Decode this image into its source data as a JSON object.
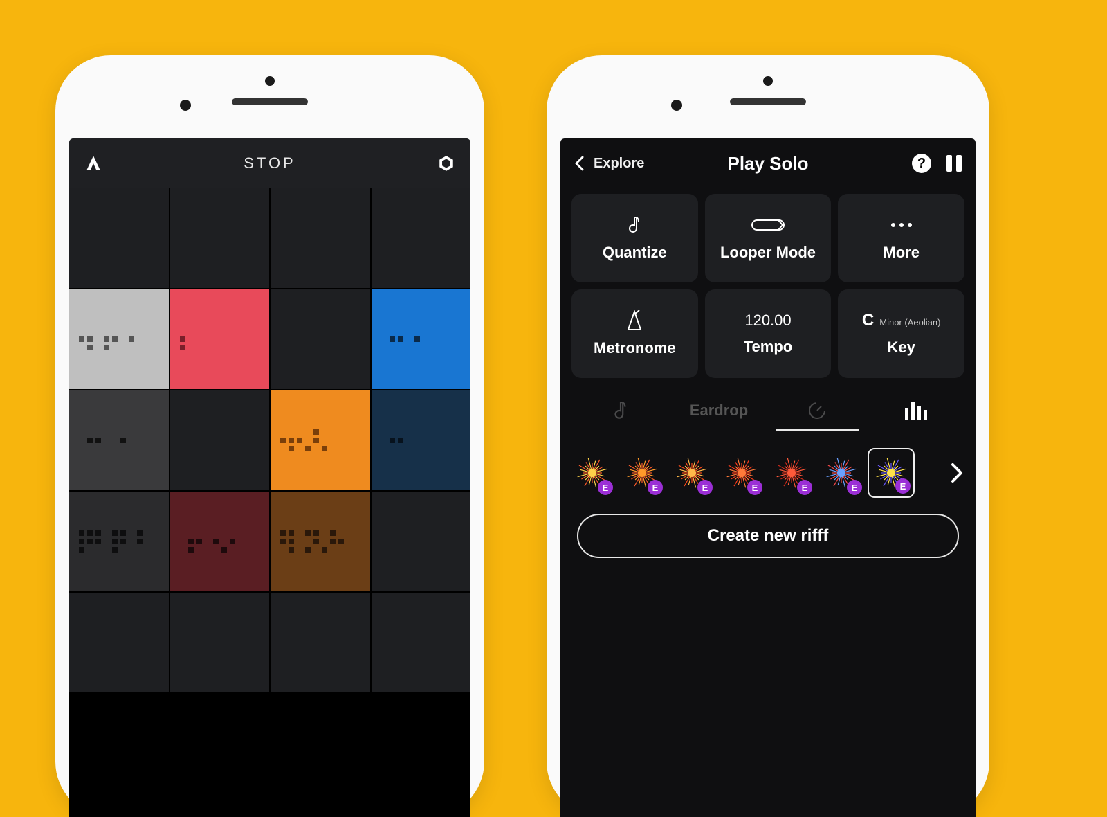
{
  "left": {
    "header_title": "STOP",
    "pads": [
      {
        "color": "#1e1f22",
        "dot_color": "#000000",
        "pattern": []
      },
      {
        "color": "#1e1f22",
        "dot_color": "#000000",
        "pattern": []
      },
      {
        "color": "#1e1f22",
        "dot_color": "#000000",
        "pattern": []
      },
      {
        "color": "#1e1f22",
        "dot_color": "#000000",
        "pattern": []
      },
      {
        "color": "#bfbfbf",
        "dot_color": "#555555",
        "pattern": [
          8,
          9,
          11,
          12,
          14,
          17,
          19
        ]
      },
      {
        "color": "#e84a5a",
        "dot_color": "#7a1f2a",
        "pattern": [
          8,
          16
        ]
      },
      {
        "color": "#1e1f22",
        "dot_color": "#000000",
        "pattern": []
      },
      {
        "color": "#1976d2",
        "dot_color": "#0a2a4a",
        "pattern": [
          9,
          10,
          12
        ]
      },
      {
        "color": "#3a3a3c",
        "dot_color": "#111111",
        "pattern": [
          9,
          10,
          13
        ]
      },
      {
        "color": "#1e1f22",
        "dot_color": "#000000",
        "pattern": []
      },
      {
        "color": "#ef8b1f",
        "dot_color": "#7a3f0a",
        "pattern": [
          4,
          9,
          10,
          12,
          8,
          17,
          19,
          21
        ]
      },
      {
        "color": "#163049",
        "dot_color": "#07121d",
        "pattern": [
          9,
          10
        ]
      },
      {
        "color": "#2b2b2d",
        "dot_color": "#0e0e0f",
        "pattern": [
          0,
          1,
          2,
          4,
          5,
          7,
          8,
          9,
          10,
          12,
          13,
          15,
          16,
          20
        ]
      },
      {
        "color": "#5a1e23",
        "dot_color": "#1e0a0c",
        "pattern": [
          9,
          10,
          12,
          14,
          17,
          21
        ]
      },
      {
        "color": "#6b3e16",
        "dot_color": "#2a180a",
        "pattern": [
          0,
          1,
          3,
          4,
          6,
          8,
          9,
          12,
          14,
          15,
          17,
          19,
          21
        ]
      },
      {
        "color": "#1e1f22",
        "dot_color": "#000000",
        "pattern": []
      },
      {
        "color": "#1e1f22",
        "dot_color": "#000000",
        "pattern": []
      },
      {
        "color": "#1e1f22",
        "dot_color": "#000000",
        "pattern": []
      },
      {
        "color": "#1e1f22",
        "dot_color": "#000000",
        "pattern": []
      },
      {
        "color": "#1e1f22",
        "dot_color": "#000000",
        "pattern": []
      }
    ]
  },
  "right": {
    "back_label": "Explore",
    "title": "Play Solo",
    "tiles": {
      "quantize": "Quantize",
      "looper": "Looper Mode",
      "more": "More",
      "metronome": "Metronome",
      "tempo_value": "120.00",
      "tempo_label": "Tempo",
      "key_note": "C",
      "key_mode": "Minor (Aeolian)",
      "key_label": "Key"
    },
    "tab_label": "Eardrop",
    "preset_badge": "E",
    "presets": [
      {
        "c1": "#ffd24a",
        "c2": "#ff5a2a",
        "selected": false
      },
      {
        "c1": "#ff9a2a",
        "c2": "#ff5a2a",
        "selected": false
      },
      {
        "c1": "#ffb84a",
        "c2": "#ff4a1a",
        "selected": false
      },
      {
        "c1": "#ff7a3a",
        "c2": "#ff3a1a",
        "selected": false
      },
      {
        "c1": "#ff5a3a",
        "c2": "#d02a1a",
        "selected": false
      },
      {
        "c1": "#6aa0ff",
        "c2": "#ff4a4a",
        "selected": false
      },
      {
        "c1": "#ffe24a",
        "c2": "#6a5aff",
        "selected": true
      }
    ],
    "create_label": "Create new rifff"
  }
}
